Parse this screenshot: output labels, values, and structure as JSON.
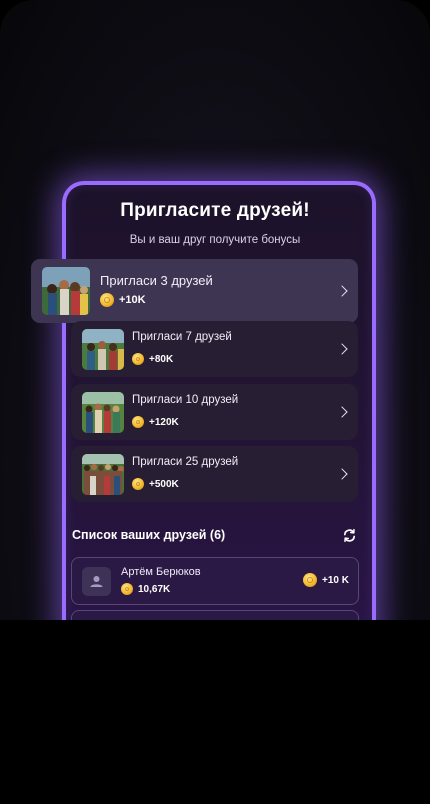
{
  "header": {
    "title": "Пригласите друзей!",
    "subtitle": "Вы и ваш друг получите бонусы"
  },
  "tasks": [
    {
      "label": "Пригласи 3 друзей",
      "reward": "+10K"
    },
    {
      "label": "Пригласи 7 друзей",
      "reward": "+80K"
    },
    {
      "label": "Пригласи 10 друзей",
      "reward": "+120K"
    },
    {
      "label": "Пригласи 25 друзей",
      "reward": "+500K"
    }
  ],
  "friends": {
    "title": "Список ваших друзей (6)",
    "list": [
      {
        "name": "Артём Берюков",
        "balance": "10,67K",
        "bonus": "+10 K"
      }
    ]
  },
  "icons": {
    "coin": "coin-icon",
    "chevron": "chevron-right-icon",
    "refresh": "refresh-icon",
    "avatar": "user-avatar-icon"
  },
  "colors": {
    "accent_glow": "#9a6bff",
    "coin": "#f5b82e"
  }
}
